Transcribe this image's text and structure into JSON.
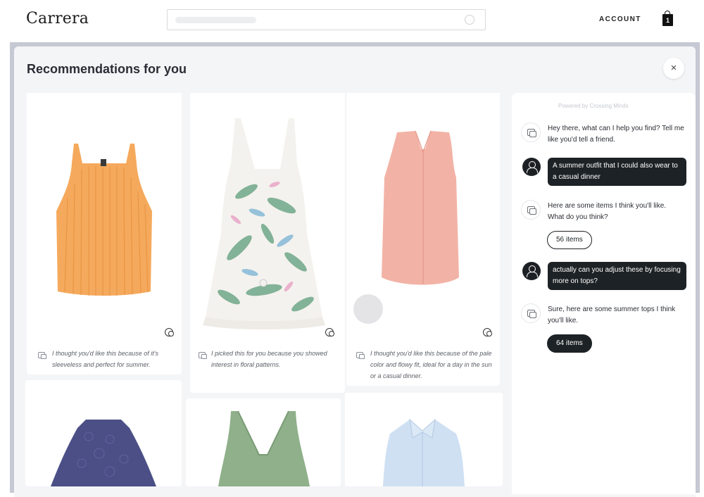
{
  "header": {
    "logo": "Carrera",
    "account_label": "ACCOUNT",
    "cart_count": "1"
  },
  "modal": {
    "title": "Recommendations for you",
    "close_label": "×"
  },
  "products": [
    {
      "reason": "I thought you'd like this because of it's sleeveless and perfect for summer."
    },
    {
      "reason": "I picked this for you because you showed interest in floral patterns."
    },
    {
      "reason": "I thought you'd like this because of the pale color and flowy fit, ideal for a day in the sun or a casual dinner."
    }
  ],
  "chat": {
    "powered_by": "Powered by  Crossing Minds",
    "messages": [
      {
        "role": "bot",
        "text": "Hey there, what can I help you find? Tell me like you'd tell a friend."
      },
      {
        "role": "user",
        "text": "A summer outfit that I could also wear to a casual dinner"
      },
      {
        "role": "bot",
        "text": "Here are some items I think you'll like. What do you think?",
        "pill": "56 items"
      },
      {
        "role": "user",
        "text": "actually can you adjust these by focusing more on tops?"
      },
      {
        "role": "bot",
        "text": "Sure, here are some summer tops I think you'll like.",
        "pill": "64 items"
      }
    ]
  },
  "colors": {
    "tank_orange": "#f5a95c",
    "dress_floral_bg": "#f3f1ee",
    "blouse_pink": "#f2b3a6",
    "lace_navy": "#4b4f86",
    "green_top": "#8fb08a",
    "blue_shirt": "#cfe0f3",
    "chat_dark": "#1d2226"
  }
}
